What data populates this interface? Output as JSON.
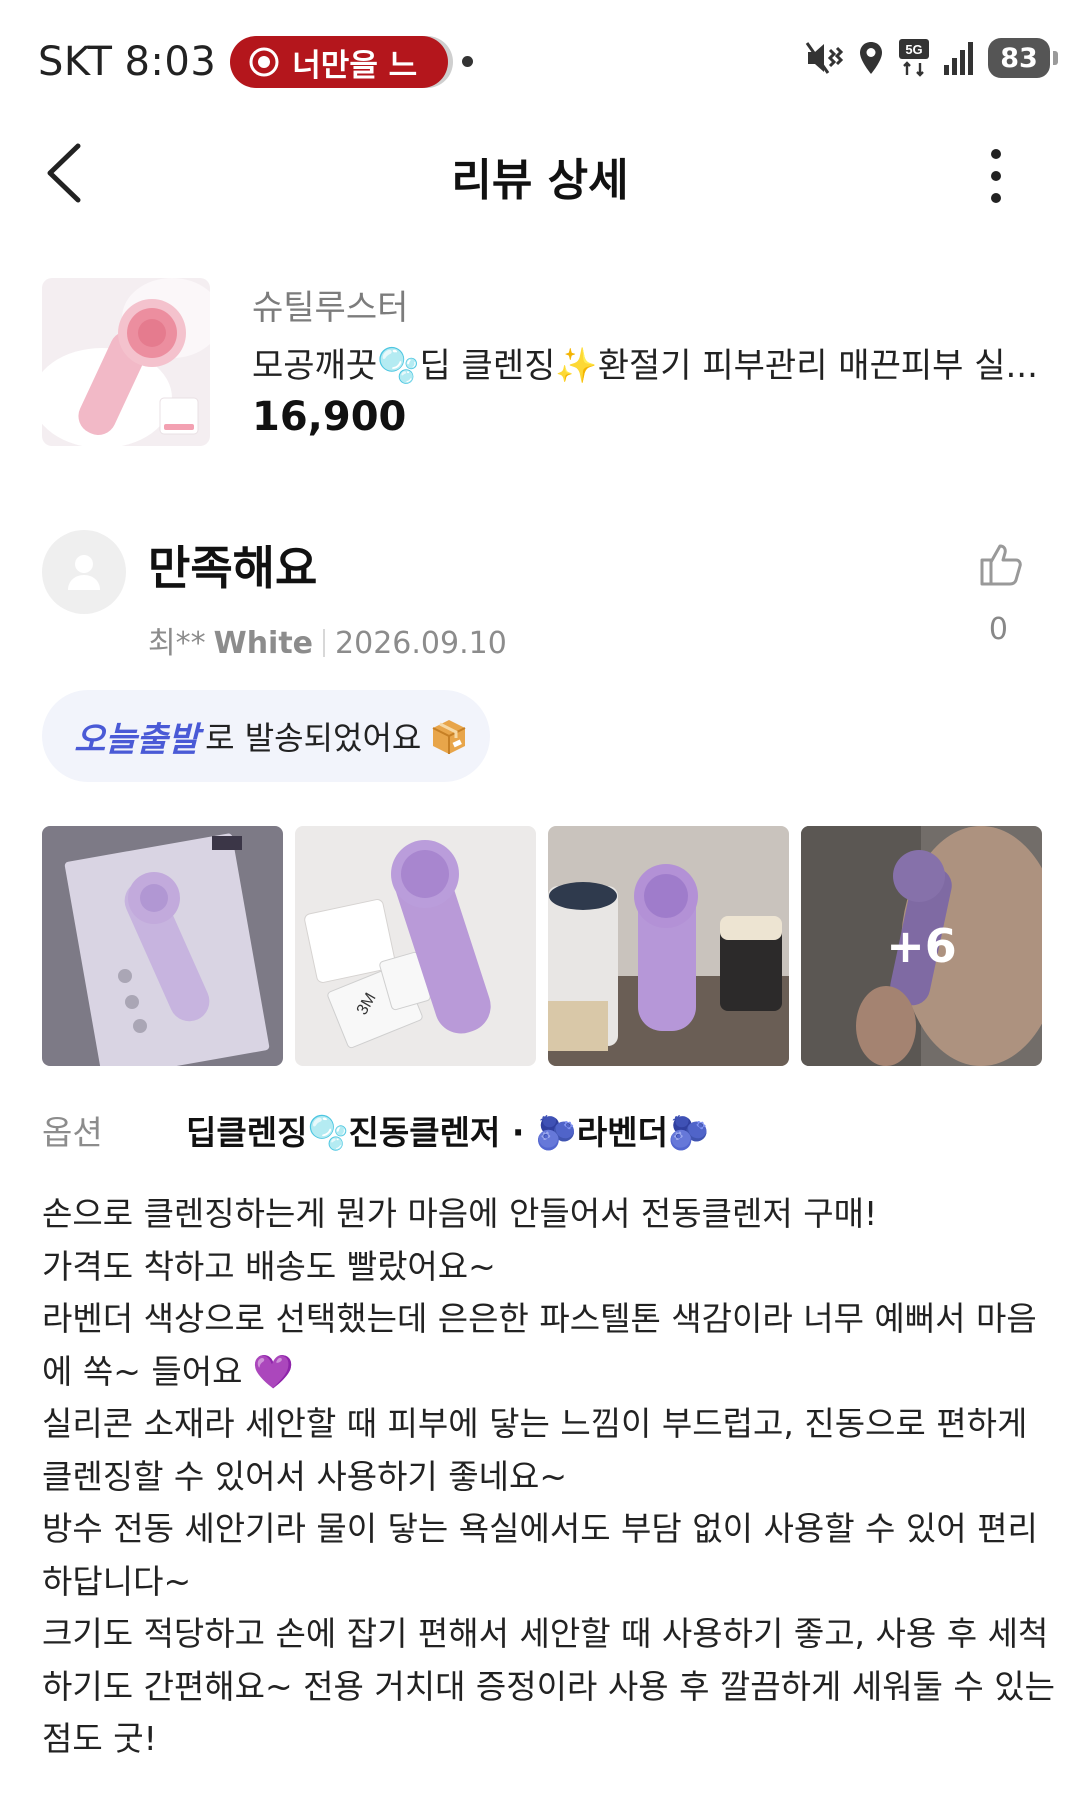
{
  "status_bar": {
    "carrier": "SKT",
    "time": "8:03",
    "recording_label": "너만을 느",
    "network": "5G",
    "battery": "83",
    "icons": [
      "record-icon",
      "mute-vibrate-icon",
      "location-icon",
      "5g-icon",
      "signal-icon",
      "battery-icon"
    ]
  },
  "nav": {
    "title": "리뷰 상세",
    "back_icon": "back-arrow-icon",
    "more_icon": "more-vertical-icon"
  },
  "product": {
    "brand": "슈틸루스터",
    "name": "모공깨끗🫧딥 클렌징✨환절기 피부관리 매끈피부 실...",
    "price": "16,900"
  },
  "review": {
    "rating_title": "만족해요",
    "reviewer": "최**",
    "grade": "White",
    "date": "2026.09.10",
    "like_count": "0",
    "shipping_brand": "오늘출발",
    "shipping_text": "로 발송되었어요",
    "more_photos": "+6",
    "option_label": "옵션",
    "option_value": "딥클렌징🫧진동클렌저 · 🫐라벤더🫐",
    "body_lines": [
      "손으로 클렌징하는게 뭔가 마음에 안들어서 전동클렌저 구매!",
      "가격도 착하고 배송도 빨랐어요~",
      "라벤더 색상으로 선택했는데 은은한 파스텔톤 색감이라 너무 예뻐서 마음",
      "에 쏙~ 들어요 💜",
      "실리콘 소재라 세안할 때 피부에 닿는 느낌이 부드럽고, 진동으로 편하게",
      "클렌징할 수 있어서 사용하기 좋네요~",
      "방수 전동 세안기라 물이 닿는 욕실에서도 부담 없이 사용할 수 있어 편리",
      "하답니다~",
      "크기도 적당하고 손에 잡기 편해서 세안할 때 사용하기 좋고, 사용 후 세척",
      "하기도 간편해요~ 전용 거치대 증정이라 사용 후 깔끔하게 세워둘 수 있는",
      "점도 굿!"
    ]
  },
  "colors": {
    "accent_blue": "#4a5ad6",
    "record_red": "#b4161c",
    "lavender": "#b99ad8",
    "muted_text": "#8c8c8c"
  }
}
